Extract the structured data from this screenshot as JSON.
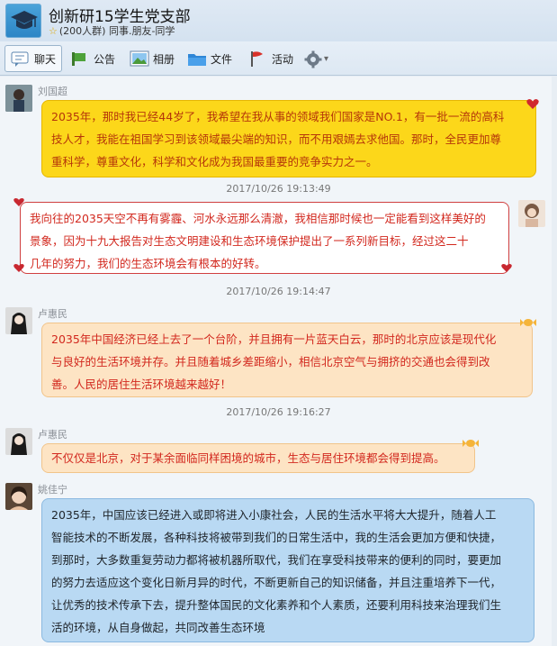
{
  "group": {
    "name": "创新研15学生党支部",
    "meta": "(200人群) 同事.朋友-同学",
    "star": "☆"
  },
  "tabs": [
    {
      "label": "聊天",
      "icon": "chat-bubble-icon"
    },
    {
      "label": "公告",
      "icon": "megaphone-icon"
    },
    {
      "label": "相册",
      "icon": "photo-icon"
    },
    {
      "label": "文件",
      "icon": "folder-icon"
    },
    {
      "label": "活动",
      "icon": "flag-icon"
    }
  ],
  "settings": {
    "icon": "gear-icon",
    "caret": "▾"
  },
  "messages": [
    {
      "sender": "刘国超",
      "text": "2035年，那时我已经44岁了，我希望在我从事的领域我们国家是NO.1，有一批一流的高科技人才，我能在祖国学习到该领域最尖端的知识，而不用艰嫣去求他国。那时，全民更加尊重科学，尊重文化，科学和文化成为我国最重要的竞争实力之一。",
      "lines": [
        "2035年，那时我已经44岁了，我希望在我从事的领域我们国家是NO.1，有一批一流的高科",
        "技人才，我能在祖国学习到该领域最尖端的知识，而不用艰嫣去求他国。那时，全民更加尊",
        "重科学，尊重文化，科学和文化成为我国最重要的竞争实力之一。"
      ],
      "style": "yellow"
    },
    {
      "timestamp": "2017/10/26 19:13:49",
      "text": "我向往的2035天空不再有雾霾、河水永远那么清澈，我相信那时候也一定能看到这样美好的景象，因为十九大报告对生态文明建设和生态环境保护提出了一系列新目标，经过这二十几年的努力，我们的生态环境会有根本的好转。",
      "lines": [
        "我向往的2035天空不再有雾霾、河水永远那么清澈，我相信那时候也一定能看到这样美好的",
        "景象，因为十九大报告对生态文明建设和生态环境保护提出了一系列新目标，经过这二十",
        "几年的努力，我们的生态环境会有根本的好转。"
      ],
      "style": "white",
      "self": true
    },
    {
      "timestamp": "2017/10/26 19:14:47",
      "sender": "卢惠民",
      "lines": [
        "2035年中国经济已经上去了一个台阶，并且拥有一片蓝天白云，那时的北京应该是现代化",
        "与良好的生活环境并存。并且随着城乡差距缩小，相信北京空气与拥挤的交通也会得到改",
        "善。人民的居住生活环境越来越好！"
      ],
      "style": "peach"
    },
    {
      "timestamp": "2017/10/26 19:16:27",
      "sender": "卢惠民",
      "lines": [
        "不仅仅是北京，对于某余面临同样困境的城市，生态与居住环境都会得到提高。"
      ],
      "style": "peach"
    },
    {
      "sender": "姚佳宁",
      "lines": [
        "2035年，中国应该已经进入或即将进入小康社会，人民的生活水平将大大提升，随着人工",
        "智能技术的不断发展，各种科技将被带到我们的日常生活中，我的生活会更加方便和快捷，",
        "到那时，大多数重复劳动力都将被机器所取代，我们在享受科技带来的便利的同时，要更加",
        "的努力去适应这个变化日新月异的时代，不断更新自己的知识储备，并且注重培养下一代，",
        "让优秀的技术传承下去，提升整体国民的文化素养和个人素质，还要利用科技来治理我们生",
        "活的环境，从自身做起，共同改善生态环境"
      ],
      "style": "blue"
    }
  ],
  "colors": {
    "yellow_bubble": "#fcd71a",
    "white_bubble_border": "#d04040",
    "peach_bubble": "#fde4c4",
    "blue_bubble": "#b9d9f3",
    "red_text": "#d2281e"
  }
}
